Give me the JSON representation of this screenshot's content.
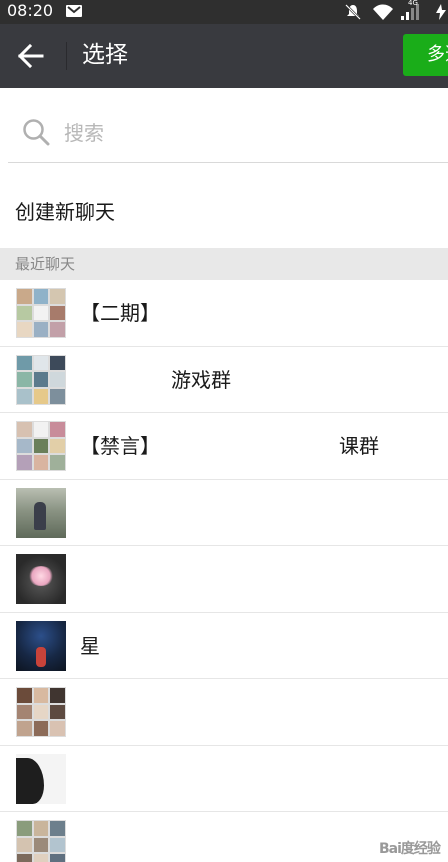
{
  "status_bar": {
    "time": "08:20",
    "network": "4G",
    "icons": [
      "notification-icon",
      "mute-icon",
      "wifi-icon",
      "signal-icon",
      "battery-icon"
    ]
  },
  "app_bar": {
    "title": "选择",
    "multi_select_label": "多选",
    "accent_color": "#1aad19",
    "background_color": "#393a3f"
  },
  "search": {
    "placeholder": "搜索",
    "value": ""
  },
  "new_chat": {
    "label": "创建新聊天"
  },
  "recent_section": {
    "label": "最近聊天"
  },
  "chats": [
    {
      "name": "【二期】",
      "avatar": "group-avatar-grid"
    },
    {
      "name": "游戏群",
      "avatar": "group-avatar-grid"
    },
    {
      "name": "【禁言】",
      "name_suffix": "课群",
      "avatar": "group-avatar-grid"
    },
    {
      "name": "",
      "avatar": "photo-avatar"
    },
    {
      "name": "",
      "avatar": "flower-avatar"
    },
    {
      "name": "星",
      "avatar": "night-photo-avatar"
    },
    {
      "name": "",
      "avatar": "group-avatar-grid"
    },
    {
      "name": "",
      "avatar": "silhouette-avatar"
    },
    {
      "name": "",
      "avatar": "group-avatar-grid"
    }
  ],
  "watermark": {
    "text": "Bai度经验"
  }
}
